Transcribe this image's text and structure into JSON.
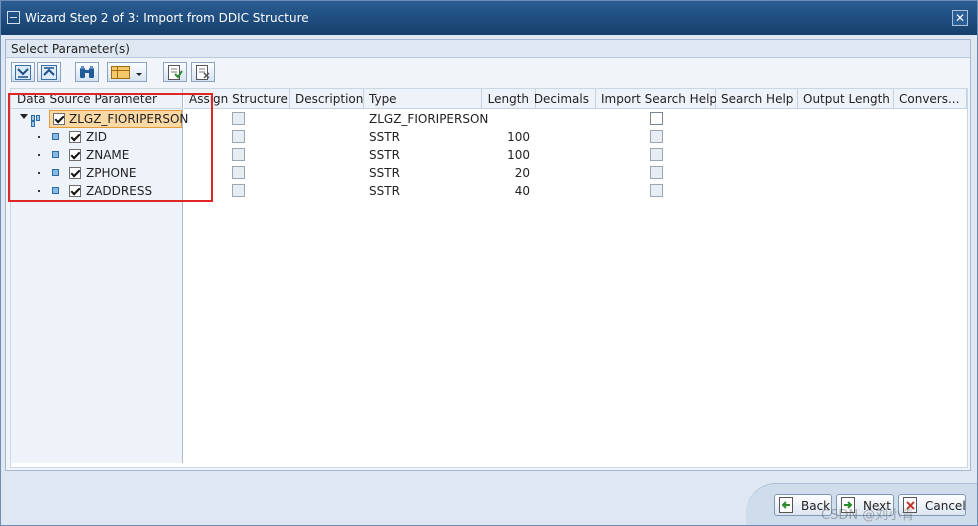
{
  "window": {
    "title": "Wizard Step 2 of 3: Import from DDIC Structure",
    "close_glyph": "✕"
  },
  "panel": {
    "title": "Select Parameter(s)"
  },
  "toolbar": {
    "buttons": [
      {
        "icon": "expand-all-icon"
      },
      {
        "icon": "collapse-all-icon"
      },
      {
        "icon": "find-icon"
      },
      {
        "icon": "layout-dropdown-icon"
      },
      {
        "icon": "select-all-icon"
      },
      {
        "icon": "deselect-all-icon"
      }
    ]
  },
  "tree": {
    "header": "Data Source Parameter",
    "root": {
      "label": "ZLGZ_FIORIPERSON",
      "checked": true
    },
    "fields": [
      {
        "label": "ZID",
        "checked": true
      },
      {
        "label": "ZNAME",
        "checked": true
      },
      {
        "label": "ZPHONE",
        "checked": true
      },
      {
        "label": "ZADDRESS",
        "checked": true
      }
    ]
  },
  "grid": {
    "columns": [
      "Assign Structure",
      "Description",
      "Type",
      "Length",
      "Decimals",
      "Import Search Help",
      "Search Help",
      "Output Length",
      "Convers..."
    ],
    "rows": [
      {
        "assign": false,
        "description": "",
        "type": "ZLGZ_FIORIPERSON",
        "length": "",
        "decimals": "",
        "import_search_help": false
      },
      {
        "assign": false,
        "description": "",
        "type": "SSTR",
        "length": "100",
        "decimals": "",
        "import_search_help": false
      },
      {
        "assign": false,
        "description": "",
        "type": "SSTR",
        "length": "100",
        "decimals": "",
        "import_search_help": false
      },
      {
        "assign": false,
        "description": "",
        "type": "SSTR",
        "length": "20",
        "decimals": "",
        "import_search_help": false
      },
      {
        "assign": false,
        "description": "",
        "type": "SSTR",
        "length": "40",
        "decimals": "",
        "import_search_help": false
      }
    ]
  },
  "footer": {
    "back_label": "Back",
    "next_label": "Next",
    "cancel_label": "Cancel",
    "watermark": "CSDN @刘小青"
  },
  "colors": {
    "title_bar": "#1f4f82",
    "selection": "#fbd9a4",
    "highlight_box": "#e02525"
  }
}
